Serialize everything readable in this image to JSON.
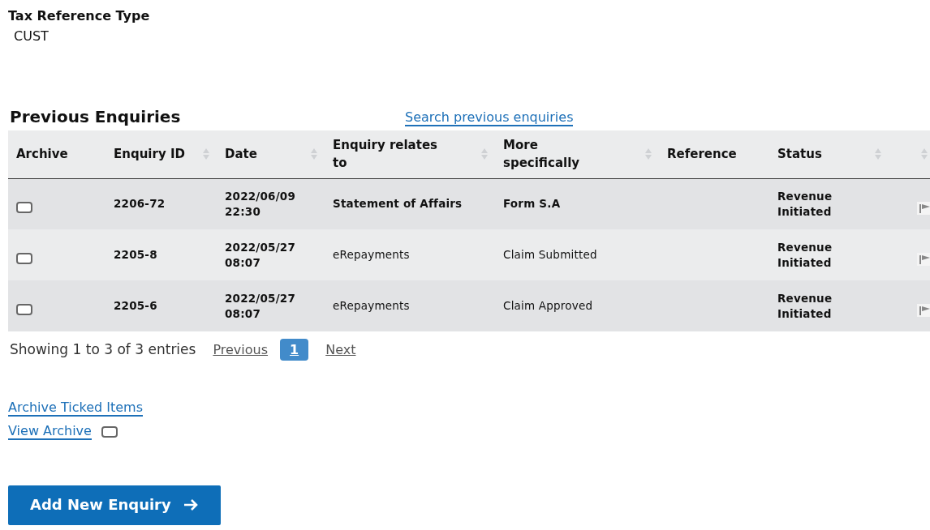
{
  "tax_reference": {
    "label": "Tax Reference Type",
    "value": "CUST"
  },
  "section_title": "Previous Enquiries",
  "search_link": "Search previous enquiries",
  "table": {
    "columns": [
      {
        "label": "Archive",
        "sortable": false
      },
      {
        "label": "Enquiry ID",
        "sortable": true
      },
      {
        "label": "Date",
        "sortable": true
      },
      {
        "label": "Enquiry relates to",
        "sortable": true
      },
      {
        "label": "More specifically",
        "sortable": true
      },
      {
        "label": "Reference",
        "sortable": false
      },
      {
        "label": "Status",
        "sortable": true
      },
      {
        "sortable": true
      }
    ],
    "rows": [
      {
        "checked": false,
        "id": "2206-72",
        "date": "2022/06/09 22:30",
        "relates_to": "Statement of Affairs",
        "more_specifically": "Form S.A",
        "status": "Revenue Initiated",
        "bold": true
      },
      {
        "checked": false,
        "id": "2205-8",
        "date": "2022/05/27 08:07",
        "relates_to": "eRepayments",
        "more_specifically": "Claim Submitted",
        "status": "Revenue Initiated",
        "bold": false
      },
      {
        "checked": false,
        "id": "2205-6",
        "date": "2022/05/27 08:07",
        "relates_to": "eRepayments",
        "more_specifically": "Claim Approved",
        "status": "Revenue Initiated",
        "bold": false
      }
    ]
  },
  "pagination": {
    "info": "Showing 1 to 3 of 3 entries",
    "previous": "Previous",
    "pages": [
      {
        "label": "1",
        "selected": true
      }
    ],
    "next": "Next"
  },
  "archive_ticked": "Archive Ticked Items",
  "view_archive": {
    "label": "View Archive",
    "checked": false
  },
  "add_button": "Add New Enquiry"
}
